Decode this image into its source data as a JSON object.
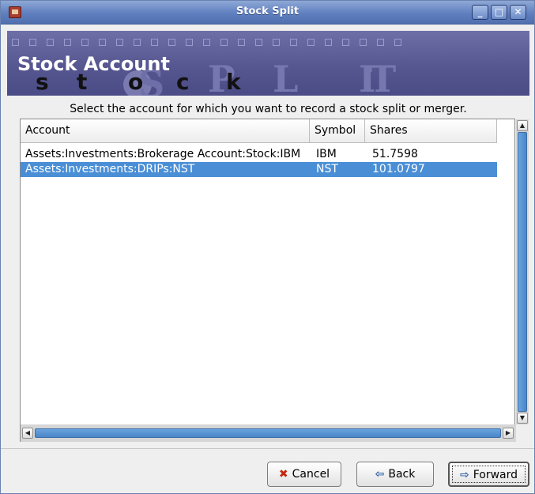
{
  "window": {
    "title": "Stock Split",
    "controls": {
      "minimize": "_",
      "maximize": "□",
      "close": "✕"
    }
  },
  "banner": {
    "title": "Stock Account",
    "letters": [
      "s",
      "t",
      "o",
      "c",
      "k"
    ],
    "watermark": [
      "S",
      "P",
      "L",
      "I",
      "T"
    ]
  },
  "instructions": "Select the account for which you want to record a stock split or merger.",
  "table": {
    "columns": [
      "Account",
      "Symbol",
      "Shares"
    ],
    "rows": [
      {
        "account": "Assets:Investments:Brokerage Account:Stock:IBM",
        "symbol": "IBM",
        "shares": "51.7598",
        "selected": false
      },
      {
        "account": "Assets:Investments:DRIPs:NST",
        "symbol": "NST",
        "shares": "101.0797",
        "selected": true
      }
    ]
  },
  "buttons": {
    "cancel": "Cancel",
    "back": "Back",
    "forward": "Forward"
  },
  "colors": {
    "selection": "#4a8fd6",
    "banner": "#565690",
    "titlebar": "#5f7fbf"
  }
}
